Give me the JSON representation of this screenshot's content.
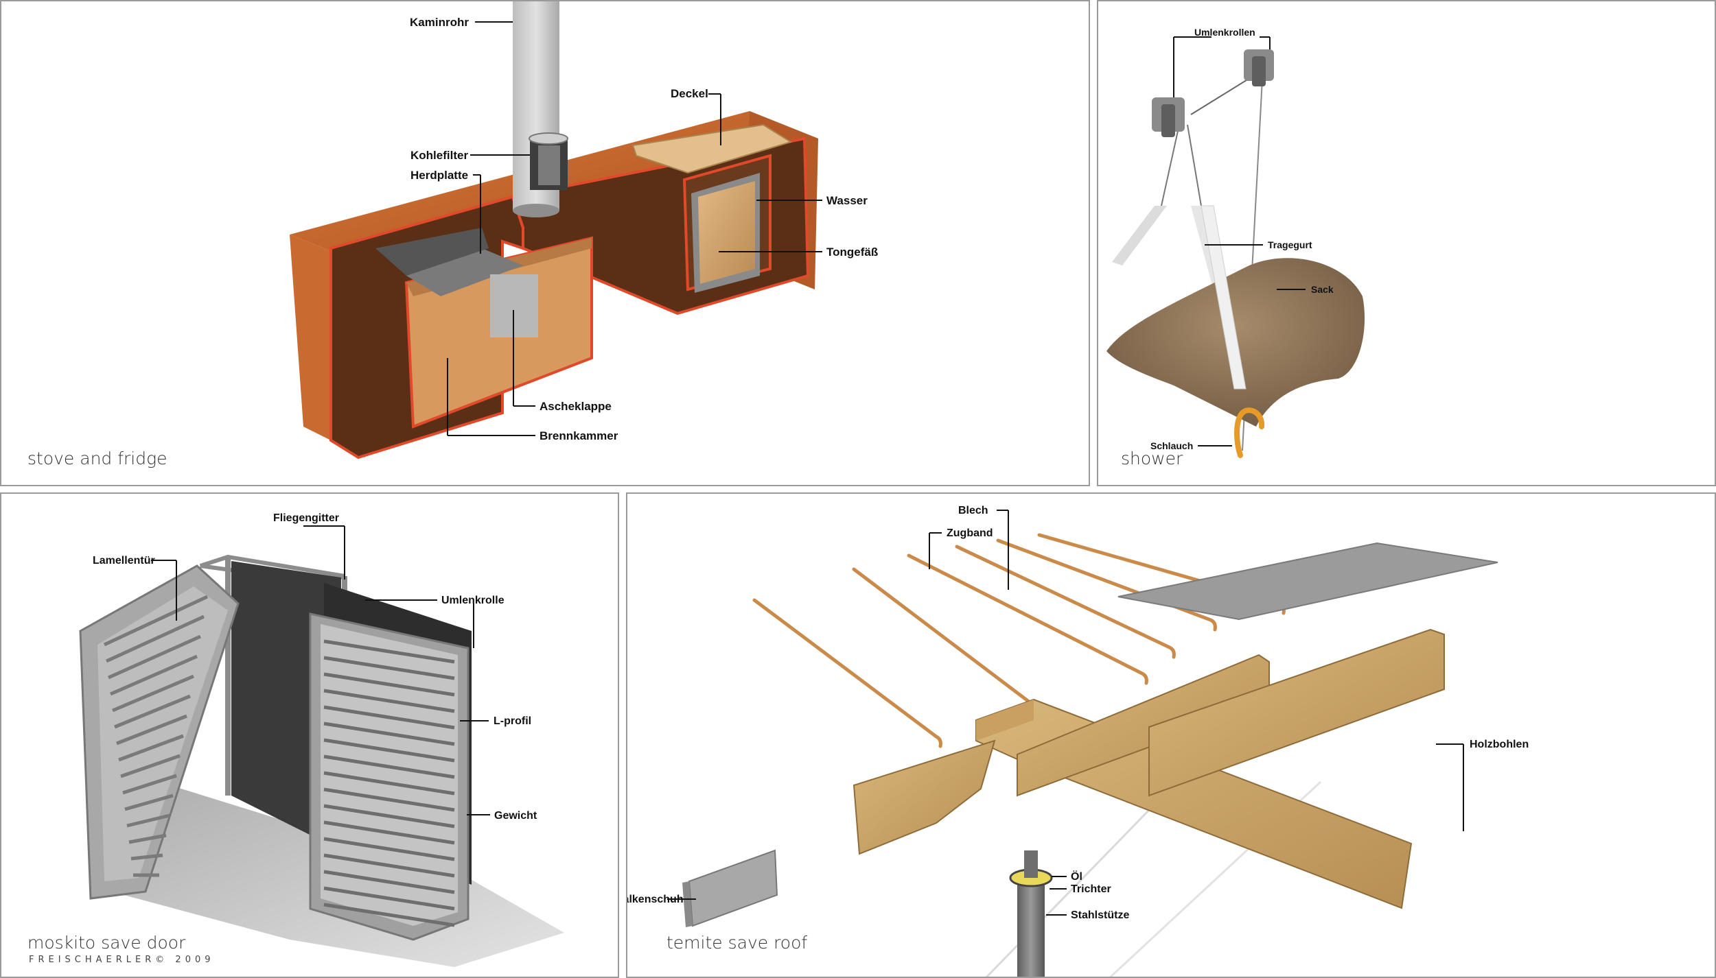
{
  "panels": {
    "stove": {
      "title": "stove and fridge",
      "labels": {
        "kaminrohr": "Kaminrohr",
        "deckel": "Deckel",
        "kohlefilter": "Kohlefilter",
        "herdplatte": "Herdplatte",
        "wasser": "Wasser",
        "tongefaess": "Tongefäß",
        "ascheklappe": "Ascheklappe",
        "brennkammer": "Brennkammer"
      }
    },
    "shower": {
      "title": "shower",
      "labels": {
        "umlenkrollen": "Umlenkrollen",
        "tragegurt": "Tragegurt",
        "sack": "Sack",
        "schlauch": "Schlauch"
      }
    },
    "door": {
      "title": "moskito save door",
      "credit": "FREISCHAERLER© 2009",
      "labels": {
        "fliegengitter": "Fliegengitter",
        "lamellentuer": "Lamellentür",
        "umlenkrolle": "Umlenkrolle",
        "lprofil": "L-profil",
        "gewicht": "Gewicht"
      }
    },
    "roof": {
      "title": "temite save roof",
      "labels": {
        "blech": "Blech",
        "zugband": "Zugband",
        "holzbohlen": "Holzbohlen",
        "oel": "Öl",
        "trichter": "Trichter",
        "balkenschuh": "Balkenschuh",
        "stahlstuetze": "Stahlstütze"
      }
    }
  },
  "colors": {
    "wood": "#c9692e",
    "wood_dark": "#a84f1f",
    "cut_face": "#5a2f16",
    "cut_edge": "#e04a2a",
    "steel": "#9c9c9c",
    "rope": "#c98a4a",
    "burlap": "#8c7355",
    "plank": "#c9a56a",
    "hose": "#e59a2a"
  }
}
